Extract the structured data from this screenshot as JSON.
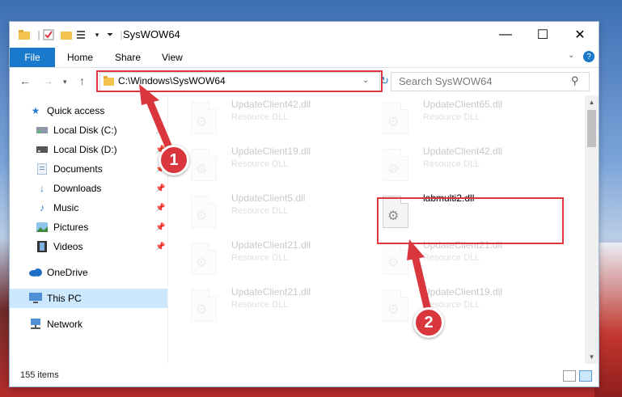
{
  "window": {
    "title": "SysWOW64"
  },
  "ribbon": {
    "file": "File",
    "tabs": [
      "Home",
      "Share",
      "View"
    ]
  },
  "address": {
    "path": "C:\\Windows\\SysWOW64"
  },
  "search": {
    "placeholder": "Search SysWOW64"
  },
  "sidebar": {
    "quick_access": "Quick access",
    "items": [
      {
        "label": "Local Disk (C:)",
        "icon": "drive-icon",
        "pinned": true
      },
      {
        "label": "Local Disk (D:)",
        "icon": "drive-icon",
        "pinned": true
      },
      {
        "label": "Documents",
        "icon": "documents-icon",
        "pinned": true
      },
      {
        "label": "Downloads",
        "icon": "download-arrow-icon",
        "pinned": true
      },
      {
        "label": "Music",
        "icon": "music-note-icon",
        "pinned": true
      },
      {
        "label": "Pictures",
        "icon": "pictures-icon",
        "pinned": true
      },
      {
        "label": "Videos",
        "icon": "film-strip-icon",
        "pinned": true
      }
    ],
    "onedrive": "OneDrive",
    "this_pc": "This PC",
    "network": "Network"
  },
  "files": [
    {
      "name": "UpdateClient42.dll",
      "type": "Resource DLL"
    },
    {
      "name": "UpdateClient65.dll",
      "type": "Resource DLL"
    },
    {
      "name": "UpdateClient19.dll",
      "type": "Resource DLL"
    },
    {
      "name": "UpdateClient42.dll",
      "type": "Resource DLL"
    },
    {
      "name": "UpdateClient5.dll",
      "type": "Resource DLL"
    },
    {
      "name": "labmulti2.dll",
      "type": ""
    },
    {
      "name": "UpdateClient21.dll",
      "type": "Resource DLL"
    },
    {
      "name": "UpdateClient21.dll",
      "type": "Resource DLL"
    },
    {
      "name": "UpdateClient21.dll",
      "type": "Resource DLL"
    },
    {
      "name": "UpdateClient19.dll",
      "type": "Resource DLL"
    }
  ],
  "status": {
    "count": "155 items"
  },
  "annotations": {
    "step1": "1",
    "step2": "2",
    "highlight_color": "#d9363e"
  }
}
